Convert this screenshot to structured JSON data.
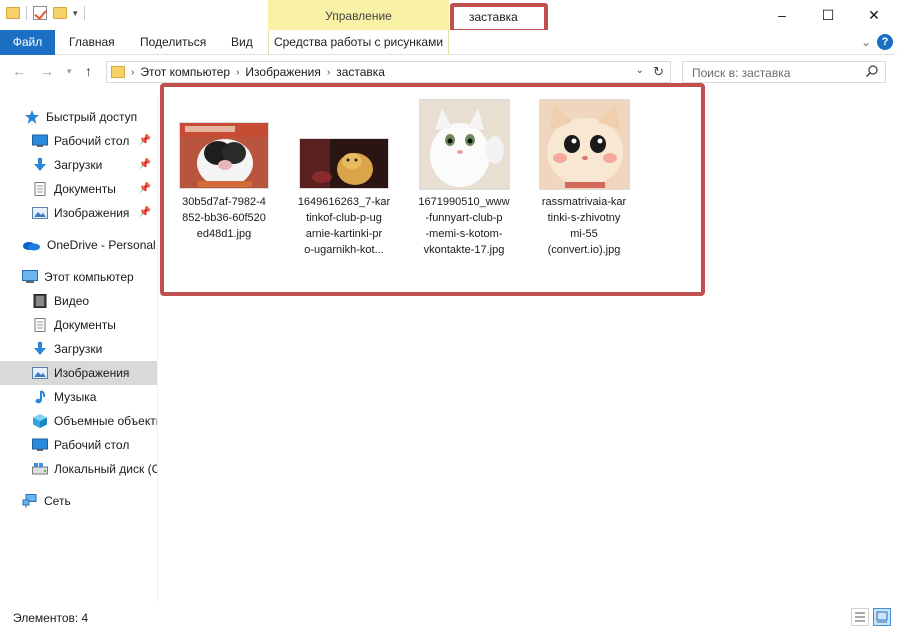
{
  "window": {
    "title": "заставка",
    "manage_tab": "Управление",
    "controls": {
      "minimize": "–",
      "maximize": "☐",
      "close": "✕"
    }
  },
  "ribbon": {
    "file_tab": "Файл",
    "tabs": [
      "Главная",
      "Поделиться",
      "Вид"
    ],
    "tools_tab": "Средства работы с рисунками",
    "help": "?"
  },
  "address": {
    "crumbs": [
      "Этот компьютер",
      "Изображения",
      "заставка"
    ],
    "search_placeholder": "Поиск в: заставка"
  },
  "sidebar": {
    "items": [
      {
        "label": "Быстрый доступ",
        "icon": "star-icon",
        "pinned": false
      },
      {
        "label": "Рабочий стол",
        "icon": "desktop-icon",
        "pinned": true
      },
      {
        "label": "Загрузки",
        "icon": "download-icon",
        "pinned": true
      },
      {
        "label": "Документы",
        "icon": "document-icon",
        "pinned": true
      },
      {
        "label": "Изображения",
        "icon": "pictures-icon",
        "pinned": true
      },
      {
        "label": "OneDrive - Personal",
        "icon": "cloud-icon",
        "pinned": false
      },
      {
        "label": "Этот компьютер",
        "icon": "computer-icon",
        "pinned": false
      },
      {
        "label": "Видео",
        "icon": "video-icon",
        "pinned": false
      },
      {
        "label": "Документы",
        "icon": "document-icon",
        "pinned": false
      },
      {
        "label": "Загрузки",
        "icon": "download-icon",
        "pinned": false
      },
      {
        "label": "Изображения",
        "icon": "pictures-icon",
        "pinned": false,
        "selected": true
      },
      {
        "label": "Музыка",
        "icon": "music-icon",
        "pinned": false
      },
      {
        "label": "Объемные объекты",
        "icon": "cube-icon",
        "pinned": false
      },
      {
        "label": "Рабочий стол",
        "icon": "desktop-icon",
        "pinned": false
      },
      {
        "label": "Локальный диск (C:)",
        "icon": "drive-icon",
        "pinned": false
      },
      {
        "label": "Сеть",
        "icon": "network-icon",
        "pinned": false
      }
    ]
  },
  "files": [
    {
      "name": "30b5d7af-7982-4852-bb36-60f520ed48d1.jpg",
      "lines": [
        "30b5d7af-7982-4",
        "852-bb36-60f520",
        "ed48d1.jpg"
      ]
    },
    {
      "name": "1649616263_7-kartinkof-club-p-ugarnie-kartinki-pro-ugarnikh-kot...",
      "lines": [
        "1649616263_7-kar",
        "tinkof-club-p-ug",
        "arnie-kartinki-pr",
        "o-ugarnikh-kot..."
      ]
    },
    {
      "name": "1671990510_www-funnyart-club-p-memi-s-kotom-vkontakte-17.jpg",
      "lines": [
        "1671990510_www",
        "-funnyart-club-p",
        "-memi-s-kotom-",
        "vkontakte-17.jpg"
      ]
    },
    {
      "name": "rassmatrivaia-kartinki-s-zhivotnymi-55 (convert.io).jpg",
      "lines": [
        "rassmatrivaia-kar",
        "tinki-s-zhivotny",
        "mi-55",
        "(convert.io).jpg"
      ]
    }
  ],
  "status": {
    "count": "Элементов: 4"
  }
}
